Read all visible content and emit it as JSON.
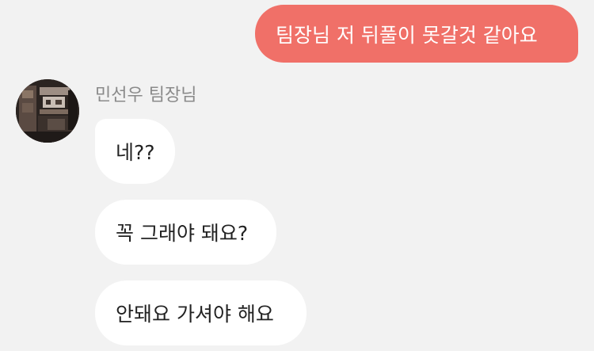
{
  "conversation": {
    "outgoing_messages": [
      {
        "text": "팀장님 저 뒤풀이 못갈것 같아요"
      }
    ],
    "sender": {
      "name": "민선우 팀장님",
      "avatar": "profile-photo-icon"
    },
    "incoming_messages": [
      {
        "text": "네??"
      },
      {
        "text": "꼭 그래야 돼요?"
      },
      {
        "text": "안돼요 가셔야 해요"
      }
    ]
  },
  "colors": {
    "background": "#f2f2f2",
    "outgoing_bubble": "#f07068",
    "incoming_bubble": "#ffffff",
    "sender_name": "#8a8a8a"
  }
}
